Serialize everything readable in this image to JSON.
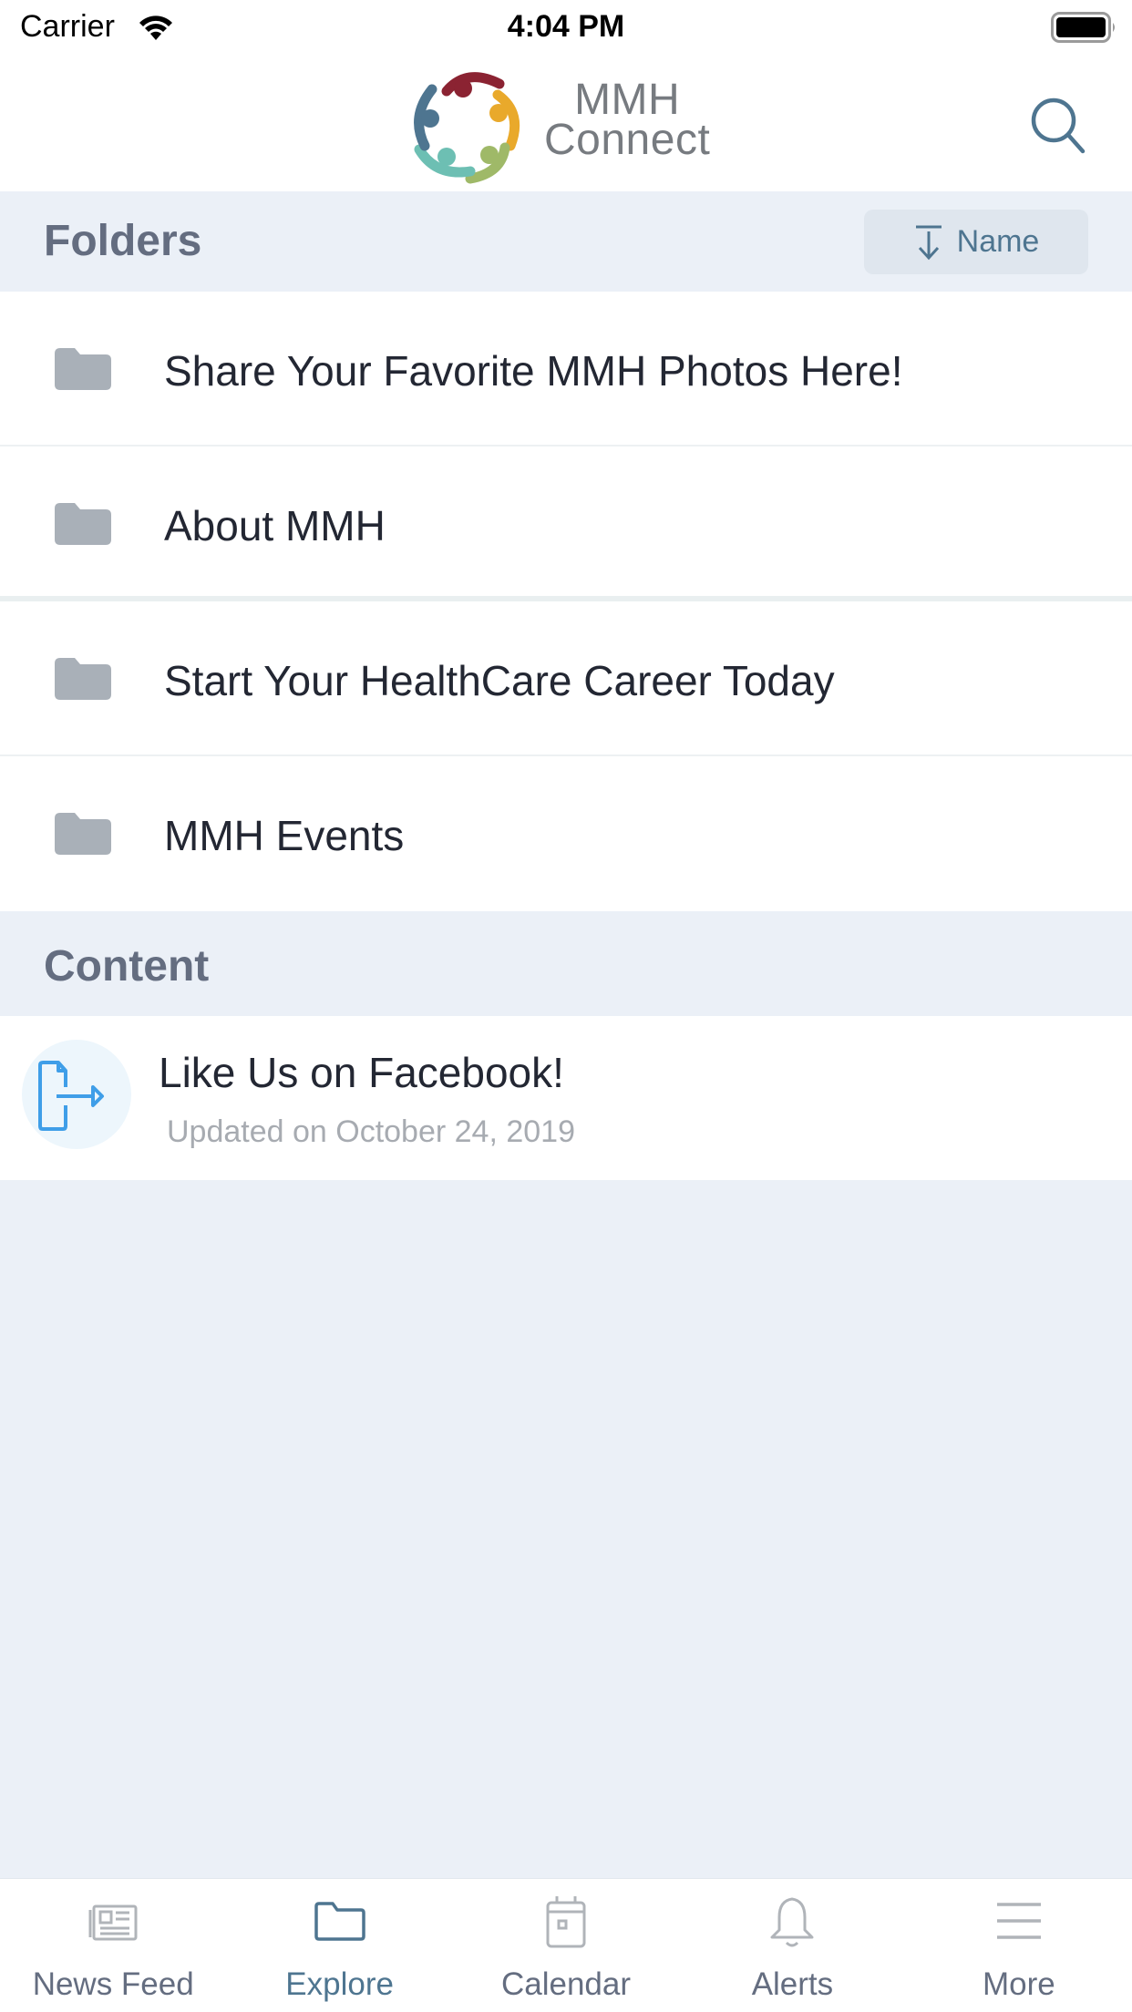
{
  "status_bar": {
    "carrier": "Carrier",
    "time": "4:04 PM",
    "wifi_icon": "wifi-icon",
    "battery_icon": "battery-full-icon"
  },
  "header": {
    "logo_icon": "people-circle-logo-icon",
    "logo_line1": "MMH",
    "logo_line2": "Connect",
    "search_icon": "search-icon",
    "logo_colors": [
      "#8b2332",
      "#e9a92b",
      "#9fb968",
      "#6dbfb3",
      "#4e7590"
    ]
  },
  "folders_section": {
    "title": "Folders",
    "sort_label": "Name",
    "sort_icon": "sort-descending-icon",
    "items": [
      {
        "name": "Share Your Favorite MMH Photos Here!",
        "icon": "folder-icon"
      },
      {
        "name": "About MMH",
        "icon": "folder-icon"
      },
      {
        "name": "Start Your HealthCare Career Today",
        "icon": "folder-icon"
      },
      {
        "name": "MMH Events",
        "icon": "folder-icon"
      }
    ]
  },
  "content_section": {
    "title": "Content",
    "items": [
      {
        "title": "Like Us on Facebook!",
        "meta": "Updated on October 24, 2019",
        "icon": "external-link-document-icon"
      }
    ]
  },
  "tab_bar": {
    "active": "Explore",
    "tabs": [
      {
        "label": "News Feed",
        "icon": "newspaper-icon"
      },
      {
        "label": "Explore",
        "icon": "folder-icon"
      },
      {
        "label": "Calendar",
        "icon": "calendar-icon"
      },
      {
        "label": "Alerts",
        "icon": "bell-icon"
      },
      {
        "label": "More",
        "icon": "menu-icon"
      }
    ]
  },
  "colors": {
    "accent": "#4e7590",
    "section_bg": "#ebf0f7",
    "section_title": "#646d80",
    "folder_icon": "#a9b0b8",
    "content_icon": "#3f9ee8"
  }
}
